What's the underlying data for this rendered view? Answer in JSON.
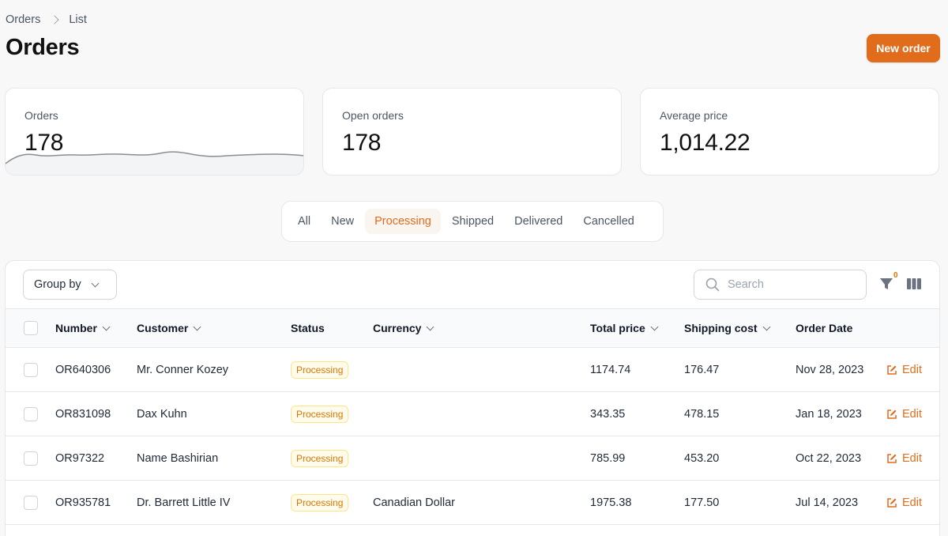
{
  "breadcrumb": {
    "items": [
      "Orders",
      "List"
    ]
  },
  "page": {
    "title": "Orders",
    "new_order_label": "New order"
  },
  "stats": [
    {
      "label": "Orders",
      "value": "178",
      "has_sparkline": true
    },
    {
      "label": "Open orders",
      "value": "178"
    },
    {
      "label": "Average price",
      "value": "1,014.22"
    }
  ],
  "tabs": [
    {
      "label": "All",
      "active": false
    },
    {
      "label": "New",
      "active": false
    },
    {
      "label": "Processing",
      "active": true
    },
    {
      "label": "Shipped",
      "active": false
    },
    {
      "label": "Delivered",
      "active": false
    },
    {
      "label": "Cancelled",
      "active": false
    }
  ],
  "toolbar": {
    "group_by_label": "Group by",
    "search_placeholder": "Search",
    "filter_count": "0"
  },
  "table": {
    "columns": [
      "Number",
      "Customer",
      "Status",
      "Currency",
      "Total price",
      "Shipping cost",
      "Order Date"
    ],
    "edit_label": "Edit",
    "rows": [
      {
        "number": "OR640306",
        "customer": "Mr. Conner Kozey",
        "status": "Processing",
        "currency": "",
        "total": "1174.74",
        "shipping": "176.47",
        "date": "Nov 28, 2023"
      },
      {
        "number": "OR831098",
        "customer": "Dax Kuhn",
        "status": "Processing",
        "currency": "",
        "total": "343.35",
        "shipping": "478.15",
        "date": "Jan 18, 2023"
      },
      {
        "number": "OR97322",
        "customer": "Name Bashirian",
        "status": "Processing",
        "currency": "",
        "total": "785.99",
        "shipping": "453.20",
        "date": "Oct 22, 2023"
      },
      {
        "number": "OR935781",
        "customer": "Dr. Barrett Little IV",
        "status": "Processing",
        "currency": "Canadian Dollar",
        "total": "1975.38",
        "shipping": "177.50",
        "date": "Jul 14, 2023"
      }
    ]
  },
  "colors": {
    "accent": "#e06c1c",
    "badge_text": "#d97706",
    "badge_bg": "#fffbeb"
  }
}
